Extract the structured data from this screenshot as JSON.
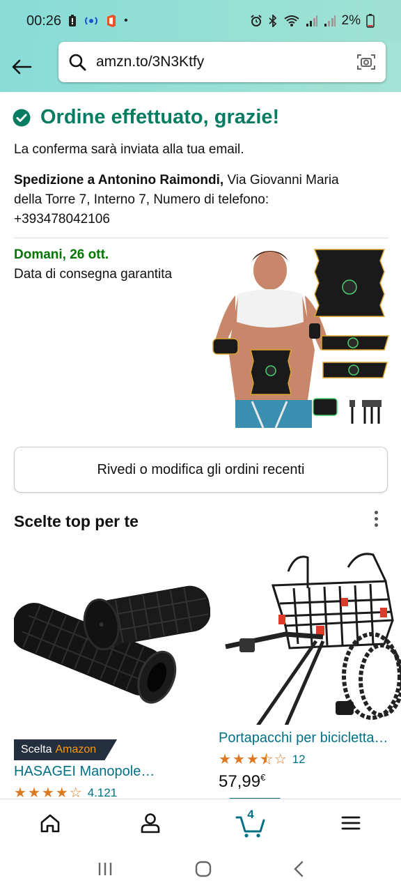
{
  "status": {
    "time": "00:26",
    "battery": "2%",
    "left_icons": [
      "battery-alert-icon",
      "hotspot-icon",
      "office-icon",
      "dot-icon"
    ],
    "right_icons": [
      "alarm-icon",
      "bluetooth-icon",
      "wifi-icon",
      "signal-icon",
      "signal-roaming-icon",
      "battery-icon"
    ]
  },
  "header": {
    "url": "amzn.to/3N3Ktfy"
  },
  "order": {
    "title": "Ordine effettuato, grazie!",
    "email_note": "La conferma sarà inviata alla tua email.",
    "ship_prefix": "Spedizione a Antonino Raimondi,",
    "ship_line1_rest": " Via Giovanni Maria",
    "ship_line2": "della Torre 7, Interno 7, Numero di telefono:",
    "ship_line3": "+393478042106",
    "delivery_date": "Domani, 26 ott.",
    "delivery_sub": "Data di consegna garantita",
    "review_button": "Rivedi o modifica gli ordini recenti"
  },
  "recommendations": {
    "title": "Scelte top per te",
    "items": [
      {
        "badge_prefix": "Scelta",
        "badge_brand": "Amazon",
        "title": "HASAGEI Manopole…",
        "rating": 4.0,
        "rating_count": "4.121"
      },
      {
        "title": "Portapacchi per bicicletta…",
        "rating": 3.5,
        "rating_count": "12",
        "price": "57,99",
        "currency": "€"
      }
    ]
  },
  "bottom_nav": {
    "cart_count": "4",
    "items": [
      "home-icon",
      "account-icon",
      "cart-icon",
      "menu-icon"
    ]
  },
  "colors": {
    "accent_green": "#067d62",
    "delivery_green": "#007600",
    "link_teal": "#007185",
    "star_orange": "#de7921",
    "header_teal": "#88dcd8"
  }
}
